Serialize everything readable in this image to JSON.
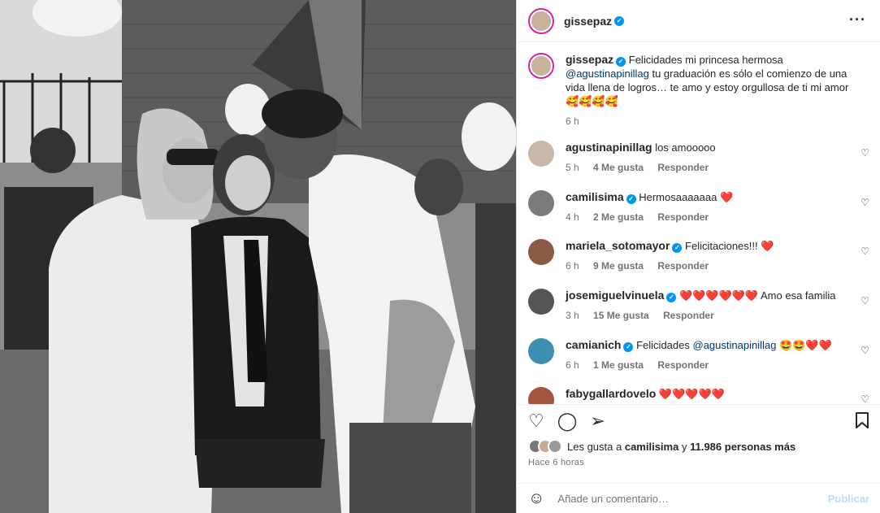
{
  "post": {
    "username": "gissepaz",
    "more_icon": "more-horizontal-icon",
    "caption": {
      "username": "gissepaz",
      "text_a": "Felicidades mi princesa hermosa",
      "mention": "@agustinapinillag",
      "text_b": "tu graduación es sólo el comienzo de una vida llena de logros… te amo y estoy orgullosa de ti mi amor",
      "emojis": "🥰🥰🥰🥰",
      "time": "6 h"
    }
  },
  "comments": [
    {
      "username": "agustinapinillag",
      "verified": false,
      "text": "los amooooo",
      "time": "5 h",
      "likes": "4 Me gusta",
      "reply": "Responder",
      "avatar_color": "#c9b7a8"
    },
    {
      "username": "camilisima",
      "verified": true,
      "text": "Hermosaaaaaaa ❤️",
      "time": "4 h",
      "likes": "2 Me gusta",
      "reply": "Responder",
      "avatar_color": "#7b7b7b"
    },
    {
      "username": "mariela_sotomayor",
      "verified": true,
      "text": "Felicitaciones!!! ❤️",
      "time": "6 h",
      "likes": "9 Me gusta",
      "reply": "Responder",
      "avatar_color": "#8a5a44"
    },
    {
      "username": "josemiguelvinuela",
      "verified": true,
      "text": "❤️❤️❤️❤️❤️❤️ Amo esa familia",
      "time": "3 h",
      "likes": "15 Me gusta",
      "reply": "Responder",
      "avatar_color": "#555555"
    },
    {
      "username": "camianich",
      "verified": true,
      "text_a": "Felicidades",
      "mention": "@agustinapinillag",
      "text_b": "🤩🤩❤️❤️",
      "time": "6 h",
      "likes": "1 Me gusta",
      "reply": "Responder",
      "avatar_color": "#3d8fb0"
    },
    {
      "username": "fabygallardovelo",
      "verified": false,
      "text": "❤️❤️❤️❤️❤️",
      "avatar_color": "#a2563f"
    }
  ],
  "actions": {
    "like_icon": "heart-icon",
    "comment_icon": "comment-icon",
    "share_icon": "share-icon",
    "save_icon": "bookmark-icon"
  },
  "likes": {
    "prefix": "Les gusta a",
    "user": "camilisima",
    "middle": "y",
    "count": "11.986 personas más"
  },
  "time_ago": "Hace 6 horas",
  "add_comment": {
    "emoji_icon": "emoji-icon",
    "placeholder": "Añade un comentario…",
    "publish": "Publicar"
  },
  "colors": {
    "verified": "#0095f6",
    "mention": "#00376b",
    "heart": "#ed4956",
    "publish_disabled": "#b2dffc"
  }
}
